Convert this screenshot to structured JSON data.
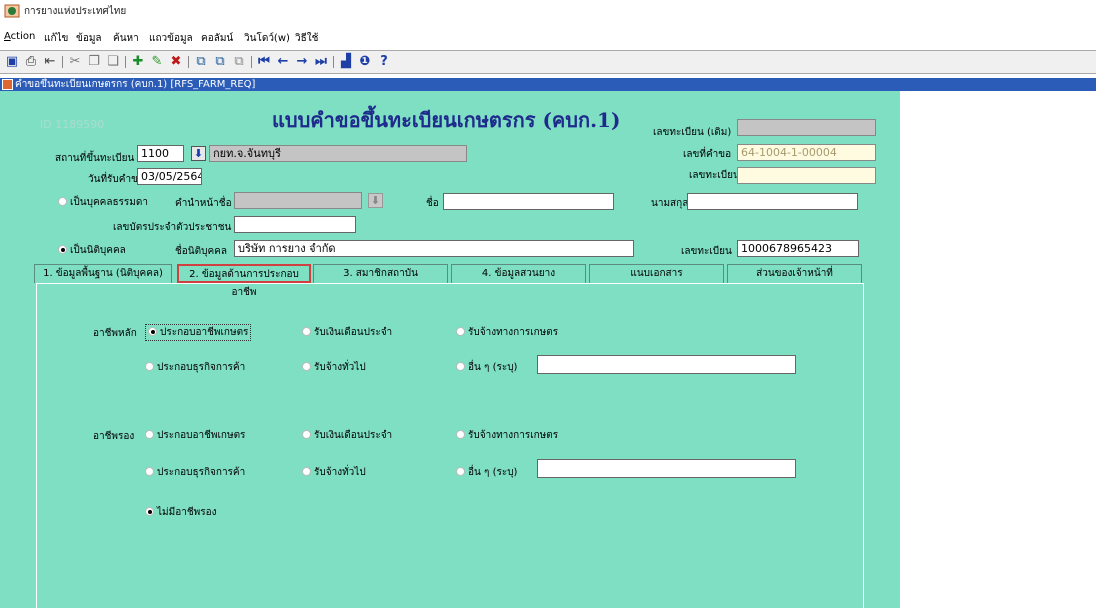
{
  "app": {
    "title": "การยางแห่งประเทศไทย"
  },
  "menu": [
    {
      "label": "Action",
      "ul": "A"
    },
    {
      "label": "แก้ไข"
    },
    {
      "label": "ข้อมูล"
    },
    {
      "label": "ค้นหา"
    },
    {
      "label": "แถวข้อมูล"
    },
    {
      "label": "คอลัมน์"
    },
    {
      "label": "วินโดว์(w)"
    },
    {
      "label": "วิธีใช้"
    }
  ],
  "window": {
    "title": "คำขอขึ้นทะเบียนเกษตรกร (คบก.1) [RFS_FARM_REQ]"
  },
  "form": {
    "id_text": "ID  1189590",
    "title": "แบบคำขอขึ้นทะเบียนเกษตรกร (คบก.1)",
    "reg_place_label": "สถานที่ขึ้นทะเบียน",
    "reg_place_code": "1100",
    "reg_place_name": "กยท.จ.จันทบุรี",
    "date_label": "วันที่รับคำขอ",
    "date_value": "03/05/2564",
    "old_reg_label": "เลขทะเบียน (เดิม)",
    "old_reg_value": "",
    "req_no_label": "เลขที่คำขอ",
    "req_no_value": "64-1004-1-00004",
    "reg_no_label": "เลขทะเบียน",
    "reg_no_value": "",
    "natural_person_label": "เป็นบุคคลธรรมดา",
    "prefix_label": "คำนำหน้าชื่อ",
    "prefix_value": "",
    "first_name_label": "ชื่อ",
    "first_name_value": "",
    "last_name_label": "นามสกุล",
    "last_name_value": "",
    "citizen_id_label": "เลขบัตรประจำตัวประชาชน",
    "citizen_id_value": "",
    "juristic_label": "เป็นนิติบุคคล",
    "juristic_name_label": "ชื่อนิติบุคคล",
    "juristic_name_value": "บริษัท การยาง จำกัด",
    "juristic_reg_label": "เลขทะเบียน",
    "juristic_reg_value": "1000678965423"
  },
  "tabs": [
    "1. ข้อมูลพื้นฐาน (นิติบุคคล)",
    "2. ข้อมูลด้านการประกอบอาชีพ",
    "3. สมาชิกสถาบัน",
    "4. ข้อมูลสวนยาง",
    "แนบเอกสาร",
    "ส่วนของเจ้าหน้าที่"
  ],
  "occupation": {
    "main_label": "อาชีพหลัก",
    "secondary_label": "อาชีพรอง",
    "opt_agri": "ประกอบอาชีพเกษตร",
    "opt_salary": "รับเงินเดือนประจำ",
    "opt_agri_hire": "รับจ้างทางการเกษตร",
    "opt_business": "ประกอบธุรกิจการค้า",
    "opt_general_hire": "รับจ้างทั่วไป",
    "opt_other": "อื่น ๆ (ระบุ)",
    "main_other_value": "",
    "secondary_other_value": "",
    "no_secondary": "ไม่มีอาชีพรอง"
  }
}
